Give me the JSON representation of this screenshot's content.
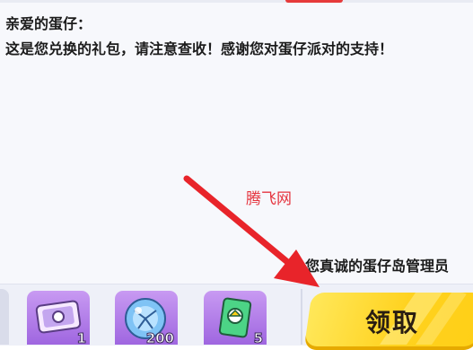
{
  "mail": {
    "greeting": "亲爱的蛋仔：",
    "body": "这是您兑换的礼包，请注意查收！感谢您对蛋仔派对的支持！",
    "signature": "您真诚的蛋仔岛管理员"
  },
  "watermark": "腾飞网",
  "rewards": [
    {
      "icon": "ticket-icon",
      "count": "1"
    },
    {
      "icon": "crystal-orb-icon",
      "count": "200"
    },
    {
      "icon": "card-icon",
      "count": "5"
    }
  ],
  "claim_button": {
    "label": "领取"
  },
  "colors": {
    "arrow": "#e8242a",
    "button": "#ffd21f",
    "reward_bg": "#b07fe9",
    "watermark": "#e5353f"
  }
}
